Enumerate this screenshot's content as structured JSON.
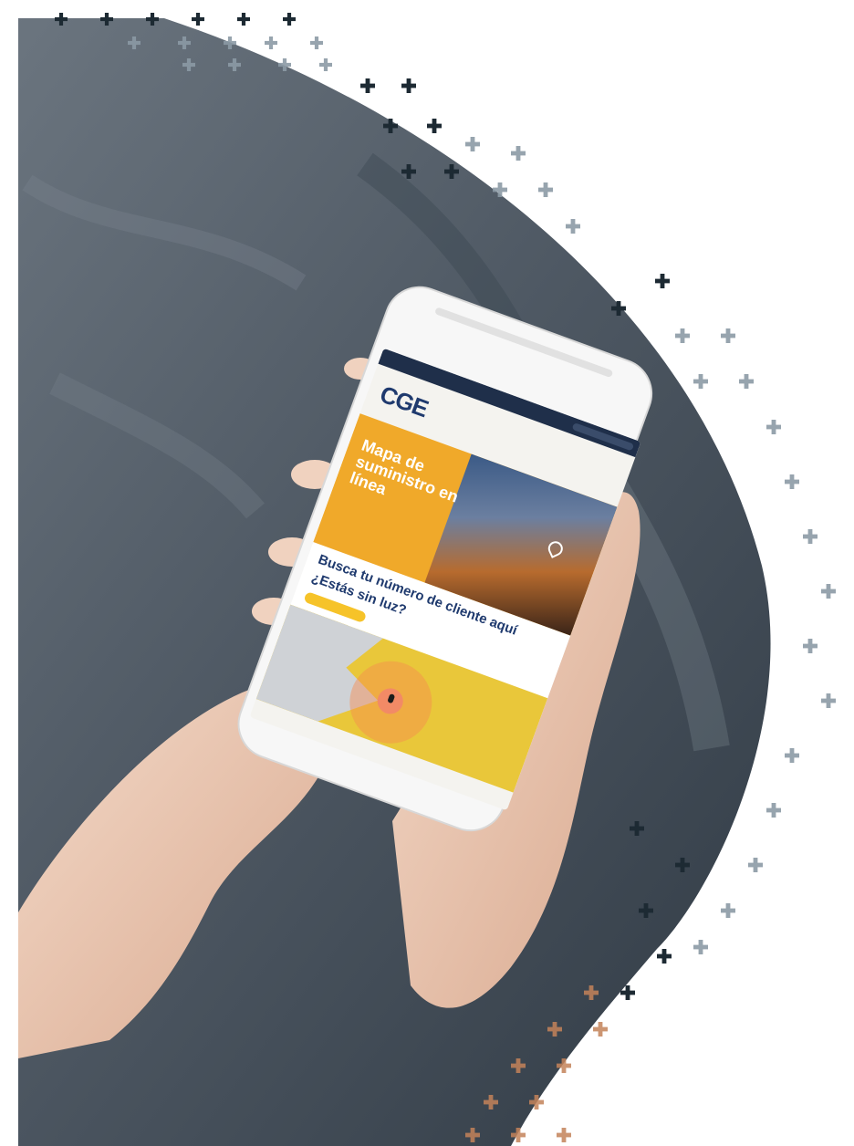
{
  "scene": {
    "description_free": true
  },
  "phone": {
    "brand": "CGE",
    "hero_title": "Mapa de suministro en línea",
    "search_prompt": "Busca tu número de cliente aquí",
    "question": "¿Estás sin luz?",
    "icons": [
      "search-icon",
      "location-pin-icon",
      "map-marker-icon",
      "menu-icon"
    ]
  },
  "colors": {
    "brand_blue": "#1f3a6e",
    "accent_yellow": "#f0a92a",
    "map_yellow": "#e9c73a",
    "denim_grey": "#4c5a68",
    "pattern_dark": "#1d2a33",
    "pattern_light": "#8c9aa5",
    "pattern_copper": "#c4835a"
  }
}
